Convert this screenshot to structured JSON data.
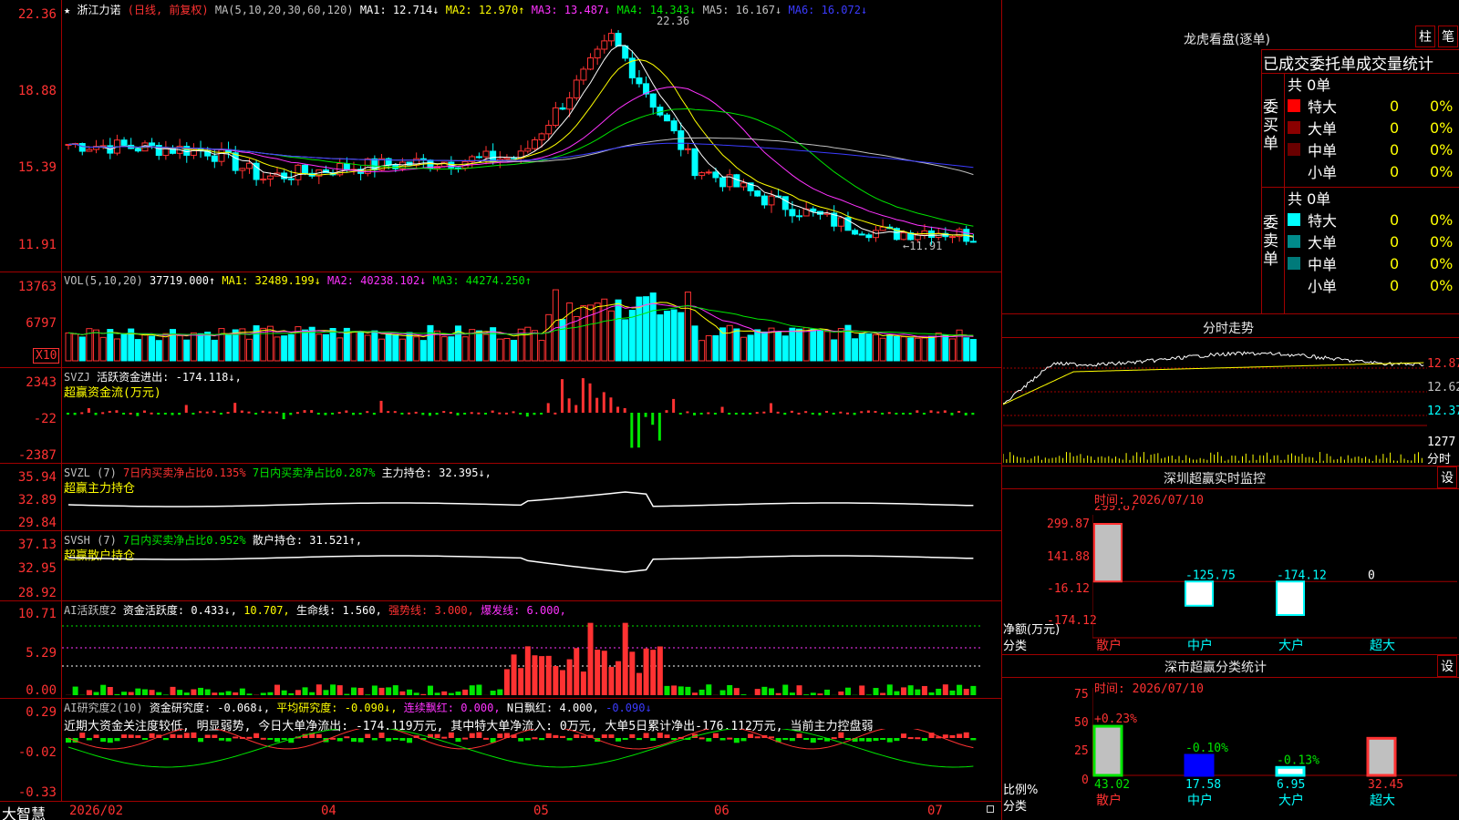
{
  "colors": {
    "up": "#ff3232",
    "down": "#00ffff",
    "ma1": "#ffffff",
    "ma2": "#ffff00",
    "ma3": "#ff33ff",
    "ma4": "#00e600",
    "ma5": "#c0c0c0",
    "ma6": "#3b3bff",
    "border": "#a00000"
  },
  "main_chart": {
    "star_icon": "★",
    "stock_name": "浙江力诺",
    "mode": "(日线, 前复权)",
    "ma_params": "MA(5,10,20,30,60,120)",
    "ma1": "MA1: 12.714↓",
    "ma2": "MA2: 12.970↑",
    "ma3": "MA3: 13.487↓",
    "ma4": "MA4: 14.343↓",
    "ma5": "MA5: 16.167↓",
    "ma6": "MA6: 16.072↓",
    "y_labels": [
      "22.36",
      "18.88",
      "15.39",
      "11.91"
    ],
    "high_note": "22.36",
    "low_note": "←11.91"
  },
  "vol_panel": {
    "title": "VOL(5,10,20)",
    "value": "37719.000↑",
    "ma1": "MA1: 32489.199↓",
    "ma2": "MA2: 40238.102↓",
    "ma3": "MA3: 44274.250↑",
    "y_labels": [
      "13763",
      "6797"
    ],
    "unit": "X10"
  },
  "svzj_panel": {
    "title": "SVZJ",
    "label": "活跃资金进出: -174.118↓,",
    "subtitle": "超赢资金流(万元)",
    "y_labels": [
      "2343",
      "-22",
      "-2387"
    ]
  },
  "svzl_panel": {
    "title": "SVZL (7)",
    "a": "7日内买卖净占比0.135%",
    "b": "7日内买卖净占比0.287%",
    "c": "主力持仓: 32.395↓,",
    "subtitle": "超赢主力持仓",
    "y_labels": [
      "35.94",
      "32.89",
      "29.84"
    ]
  },
  "svsh_panel": {
    "title": "SVSH (7)",
    "a": "7日内买卖净占比0.952%",
    "b": "散户持仓: 31.521↑,",
    "subtitle": "超赢散户持仓",
    "y_labels": [
      "37.13",
      "32.95",
      "28.92"
    ]
  },
  "ai_active_panel": {
    "title": "AI活跃度2",
    "a": "资金活跃度: 0.433↓,",
    "b": "10.707,",
    "c": "生命线: 1.560,",
    "d": "强势线: 3.000,",
    "e": "爆发线: 6.000,",
    "y_labels": [
      "10.71",
      "5.29",
      "0.00"
    ]
  },
  "ai_research_panel": {
    "title": "AI研究度2(10)",
    "a": "资金研究度: -0.068↓,",
    "b": "平均研究度: -0.090↓,",
    "c": "连续飘红: 0.000,",
    "d": "N日飘红: 4.000,",
    "e": "-0.090↓",
    "comment": "近期大资金关注度较低, 明显弱势, 今日大单净流出: -174.119万元, 其中特大单净流入: 0万元, 大单5日累计净出-176.112万元, 当前主力控盘弱",
    "y_labels": [
      "0.29",
      "-0.02",
      "-0.33"
    ]
  },
  "bottom_axis": {
    "brand": "大智慧",
    "dates": [
      "2026/02",
      "04",
      "05",
      "06",
      "07"
    ]
  },
  "lhb": {
    "title": "龙虎看盘(逐单)",
    "btn_bar": "柱",
    "btn_pen": "笔",
    "stats_title": "已成交委托单成交量统计",
    "buy_label": "委买单",
    "sell_label": "委卖单",
    "buy_total": "共 0单",
    "sell_total": "共 0单",
    "buy_rows": [
      {
        "name": "特大",
        "count": "0",
        "pct": "0%",
        "color": "#ff0000"
      },
      {
        "name": "大单",
        "count": "0",
        "pct": "0%",
        "color": "#8b0000"
      },
      {
        "name": "中单",
        "count": "0",
        "pct": "0%",
        "color": "#6a0000"
      },
      {
        "name": "小单",
        "count": "0",
        "pct": "0%",
        "color": ""
      }
    ],
    "sell_rows": [
      {
        "name": "特大",
        "count": "0",
        "pct": "0%",
        "color": "#00ffff"
      },
      {
        "name": "大单",
        "count": "0",
        "pct": "0%",
        "color": "#008b8b"
      },
      {
        "name": "中单",
        "count": "0",
        "pct": "0%",
        "color": "#007a7a"
      },
      {
        "name": "小单",
        "count": "0",
        "pct": "0%",
        "color": ""
      }
    ]
  },
  "intraday": {
    "title": "分时走势",
    "y_labels": [
      "12.87",
      "12.62",
      "12.37"
    ],
    "vol_label": "1277",
    "vol_unit": "分时"
  },
  "monitor": {
    "title": "深圳超赢实时监控",
    "btn": "设",
    "time": "时间: 2026/07/10",
    "y_labels": [
      "299.87",
      "141.88",
      "-16.12",
      "-174.12"
    ],
    "unit_label": "净额(万元)",
    "cat_label": "分类",
    "categories": [
      "散户",
      "中户",
      "大户",
      "超大"
    ],
    "values": [
      299.87,
      -125.75,
      -174.12,
      0
    ],
    "value_labels": [
      "299.87",
      "-125.75",
      "-174.12",
      "0"
    ]
  },
  "classify": {
    "title": "深市超赢分类统计",
    "btn": "设",
    "time": "时间: 2026/07/10",
    "y_labels": [
      "75",
      "50",
      "25",
      "0"
    ],
    "ratio_label": "比例%",
    "cat_label": "分类",
    "categories": [
      "散户",
      "中户",
      "大户",
      "超大"
    ],
    "values": [
      43.02,
      17.58,
      6.95,
      32.45
    ],
    "value_labels": [
      "43.02",
      "17.58",
      "6.95",
      "32.45"
    ],
    "changes": [
      "+0.23%",
      "-0.10%",
      "-0.13%",
      ""
    ]
  }
}
